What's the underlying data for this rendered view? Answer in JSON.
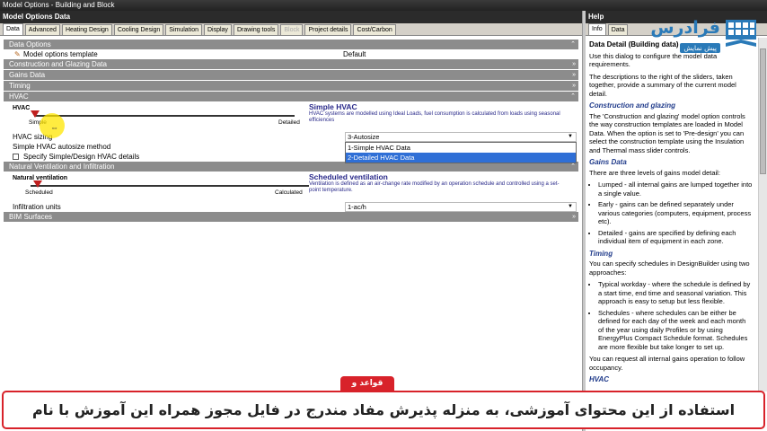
{
  "window": {
    "title": "Model Options - Building and Block"
  },
  "left_panel": {
    "header": "Model Options Data",
    "tabs": [
      {
        "label": "Data",
        "active": true
      },
      {
        "label": "Advanced"
      },
      {
        "label": "Heating Design"
      },
      {
        "label": "Cooling Design"
      },
      {
        "label": "Simulation"
      },
      {
        "label": "Display"
      },
      {
        "label": "Drawing tools"
      },
      {
        "label": "Block",
        "disabled": true
      },
      {
        "label": "Project details"
      },
      {
        "label": "Cost/Carbon"
      }
    ],
    "sections": {
      "data_options": "Data Options",
      "construction": "Construction and Glazing Data",
      "gains": "Gains Data",
      "timing": "Timing",
      "hvac": "HVAC",
      "natvent": "Natural Ventilation and Infiltration",
      "bim": "BIM Surfaces"
    },
    "model_template": {
      "label": "Model options template",
      "value": "Default"
    },
    "hvac_slider": {
      "title": "HVAC",
      "left": "Simple",
      "right": "Detailed",
      "desc_title": "Simple HVAC",
      "desc_text": "HVAC systems are modelled using Ideal Loads, fuel consumption is calculated from loads using seasonal efficiences"
    },
    "hvac_sizing": {
      "label": "HVAC sizing",
      "value": "3-Autosize"
    },
    "autosize_method": {
      "label": "Simple HVAC autosize method"
    },
    "specify_details": {
      "label": "Specify Simple/Design HVAC details"
    },
    "dropdown_options": [
      "1-Simple HVAC Data",
      "2-Detailed HVAC Data"
    ],
    "vent_slider": {
      "title": "Natural ventilation",
      "left": "Scheduled",
      "right": "Calculated",
      "desc_title": "Scheduled ventilation",
      "desc_text": "Ventilation is defined as an air-change rate modified by an operation schedule and controlled using a set-point temperature."
    },
    "infiltration": {
      "label": "Infiltration units",
      "value": "1-ac/h"
    },
    "chevron": "»"
  },
  "help_panel": {
    "header": "Help",
    "tabs": [
      {
        "label": "Info",
        "active": true
      },
      {
        "label": "Data"
      }
    ],
    "title": "Data Detail (Building data)",
    "intro": "Use this dialog to configure the model data requirements.",
    "intro2": "The descriptions to the right of the sliders, taken together, provide a summary of the current model detail.",
    "construction_head": "Construction and glazing",
    "construction_text": "The 'Construction and glazing' model option controls the way construction templates are loaded in Model Data. When the option is set to 'Pre-design' you can select the construction template using the Insulation and Thermal mass slider controls.",
    "gains_head": "Gains Data",
    "gains_text": "There are three levels of gains model detail:",
    "gains_items": [
      "Lumped - all internal gains are lumped together into a single value.",
      "Early - gains can be defined separately under various categories (computers, equipment, process etc).",
      "Detailed - gains are specified by defining each individual item of equipment in each zone."
    ],
    "timing_head": "Timing",
    "timing_text": "You can specify schedules in DesignBuilder using two approaches:",
    "timing_items": [
      "Typical workday - where the schedule is defined by a start time, end time and seasonal variation. This approach is easy to setup but less flexible.",
      "Schedules - where schedules can be either be defined for each day of the week and each month of the year using daily Profiles or by using EnergyPlus Compact Schedule format. Schedules are more flexible but take longer to set up."
    ],
    "timing_text2": "You can request all internal gains operation to follow occupancy.",
    "hvac_head": "HVAC"
  },
  "watermark": {
    "brand": "فرادرس",
    "tag": "پیش نمایش"
  },
  "footer": {
    "badge": "قواعد و قوانین",
    "license": "استفاده از این محتوای آموزشی، به منزله پذیرش مفاد مندرج در فایل مجوز همراه این آموزش با نام License.pdf است."
  },
  "colors": {
    "section_bar": "#8c8c8c",
    "accent_blue": "#2f6fd6",
    "brand_blue": "#2a7ab8",
    "badge_red": "#d8222a"
  }
}
